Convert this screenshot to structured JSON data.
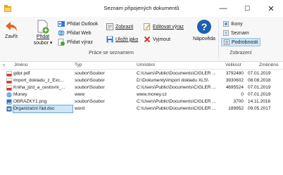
{
  "window": {
    "title": "Seznam připojených dokumentů",
    "minimize": "—",
    "maximize": "☐",
    "close": "✕"
  },
  "ribbon": {
    "close_label": "Zavřít",
    "add_label_1": "Přidat",
    "add_label_2": "soubor",
    "add_outlook": "Přidat Outlook",
    "add_web": "Přidat Web",
    "add_scan": "Přidat výraz",
    "group_label": "Práce se seznamem",
    "show": "Zobrazit",
    "save_as": "Uložit jako",
    "edit_expr": "Editovat výraz",
    "remove": "Vyjmout",
    "help": "Nápověda",
    "views": {
      "icons": "Ikony",
      "list": "Seznam",
      "details": "Podrobnosti",
      "group_label": "Zobrazení"
    }
  },
  "table": {
    "columns": [
      "Jméno",
      "Typ",
      "Umístění",
      "Velikost",
      "Změněno"
    ],
    "rows": [
      {
        "name": "gdpr.pdf",
        "type": "soubor\\Soubor",
        "location": "C:\\Users\\Public\\Documents\\CIGLER ...",
        "size": "3792480",
        "modified": "07.01.2019",
        "icon": "pdf-icon"
      },
      {
        "name": "Import_dokladu_z_Exc...",
        "type": "soubor\\Soubor",
        "location": "D:\\Dokumenty\\Import dokladu XLS\\",
        "size": "3930602",
        "modified": "08.08.2018",
        "icon": "pdf-icon"
      },
      {
        "name": "Kniha_jizd_a_cestovni_...",
        "type": "soubor\\Soubor",
        "location": "C:\\Users\\Public\\Documents\\CIGLER ...",
        "size": "4695524",
        "modified": "07.01.2019",
        "icon": "pdf-icon"
      },
      {
        "name": "Money",
        "type": "www",
        "location": "www.money.cz",
        "size": "0",
        "modified": "07.01.2019",
        "icon": "web-icon"
      },
      {
        "name": "OBRAZKY1.png",
        "type": "soubor\\Soubor",
        "location": "C:\\Users\\Public\\Documents\\CIGLER ...",
        "size": "3700",
        "modified": "14.11.2018",
        "icon": "image-icon"
      },
      {
        "name": "Organizační řád.doc",
        "type": "word",
        "location": "C:\\Users\\Public\\Documents\\CIGLER ...",
        "size": "189952",
        "modified": "09.05.2017",
        "icon": "word-icon"
      }
    ]
  }
}
